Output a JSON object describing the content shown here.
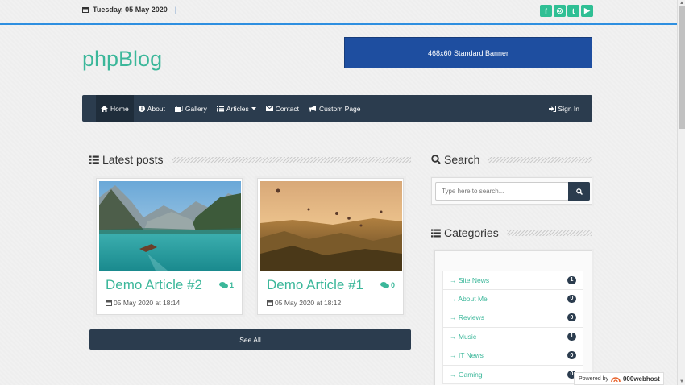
{
  "topbar": {
    "date": "Tuesday, 05 May 2020",
    "separator": "|",
    "social": [
      {
        "name": "facebook-icon",
        "glyph": "f"
      },
      {
        "name": "instagram-icon",
        "glyph": "◎"
      },
      {
        "name": "twitter-icon",
        "glyph": "t"
      },
      {
        "name": "youtube-icon",
        "glyph": "▶"
      }
    ]
  },
  "header": {
    "logo": "phpBlog",
    "banner": "468x60 Standard Banner"
  },
  "nav": {
    "items": [
      {
        "label": "Home",
        "icon": "home-icon"
      },
      {
        "label": "About",
        "icon": "info-icon"
      },
      {
        "label": "Gallery",
        "icon": "images-icon"
      },
      {
        "label": "Articles",
        "icon": "list-icon"
      },
      {
        "label": "Contact",
        "icon": "envelope-icon"
      },
      {
        "label": "Custom Page",
        "icon": "bullhorn-icon"
      }
    ],
    "signin": "Sign In"
  },
  "latest": {
    "title": "Latest posts",
    "posts": [
      {
        "title": "Demo Article #2",
        "comments": "1",
        "date": "05 May 2020 at 18:14"
      },
      {
        "title": "Demo Article #1",
        "comments": "0",
        "date": "05 May 2020 at 18:12"
      }
    ],
    "see_all": "See All"
  },
  "search": {
    "title": "Search",
    "placeholder": "Type here to search..."
  },
  "categories": {
    "title": "Categories",
    "items": [
      {
        "label": "Site News",
        "count": "1"
      },
      {
        "label": "About Me",
        "count": "0"
      },
      {
        "label": "Reviews",
        "count": "0"
      },
      {
        "label": "Music",
        "count": "1"
      },
      {
        "label": "IT News",
        "count": "0"
      },
      {
        "label": "Gaming",
        "count": "0"
      }
    ]
  },
  "footer": {
    "powered_by": "Powered by",
    "host": "000webhost"
  },
  "colors": {
    "accent": "#3bb79a",
    "navbar": "#2b3c4e",
    "banner": "#1e4ea0",
    "topline": "#2e8fe0"
  }
}
